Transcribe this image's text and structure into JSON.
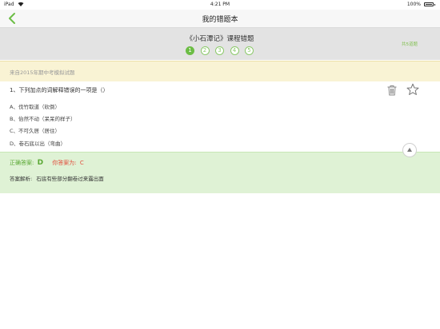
{
  "status_bar": {
    "carrier": "iPad",
    "time": "4:21 PM",
    "battery": "100%"
  },
  "nav": {
    "title": "我的错题本",
    "back_icon": "chevron-left-icon"
  },
  "course": {
    "title": "《小石潭记》课程错题",
    "count_label": "共5道题",
    "pages": [
      "1",
      "2",
      "3",
      "4",
      "5"
    ],
    "active_page": "1"
  },
  "question": {
    "source": "来自2015年期中考模拟试题",
    "text": "1、下列加点的词解释错误的一项是（）",
    "options": [
      "A、伐竹取道（砍倒）",
      "B、佁然不动（呆呆的样子）",
      "C、不可久居（居住）",
      "D、卷石底以出（弯曲）"
    ]
  },
  "answer": {
    "correct_label": "正确答案:",
    "correct_value": "D",
    "your_label": "你答案为:",
    "your_value": "C",
    "analysis_label": "答案解析:",
    "analysis_text": "石底有些部分翻卷过来露出面"
  },
  "colors": {
    "accent_green": "#6cbd45",
    "wrong_red": "#e24d3c",
    "source_bg": "#f9f3d4",
    "answer_bg": "#dff2d5"
  },
  "icons": {
    "delete": "trash-icon",
    "favorite": "star-icon",
    "collapse": "chevron-up-icon"
  }
}
